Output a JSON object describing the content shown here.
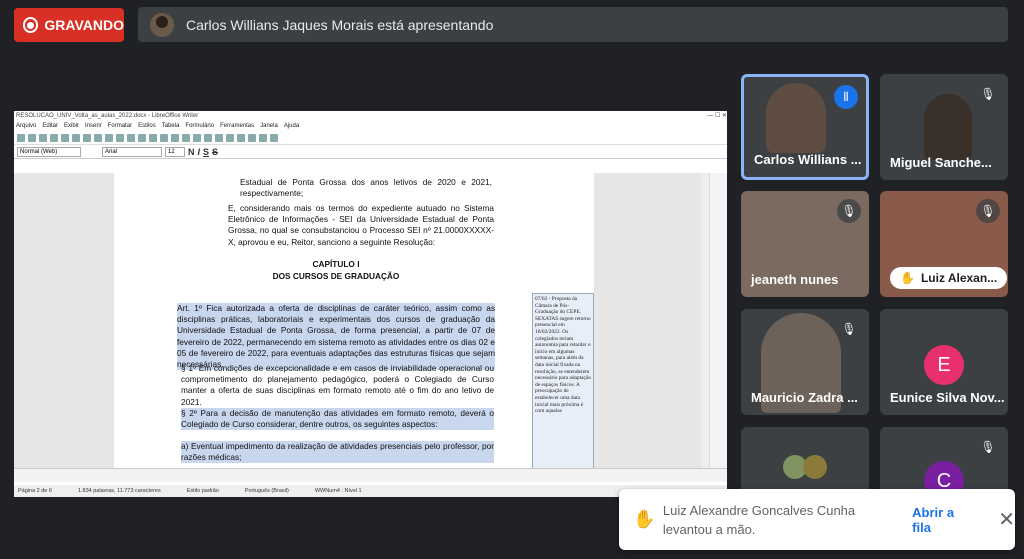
{
  "recording": {
    "label": "GRAVANDO"
  },
  "presenter": {
    "text": "Carlos Willians Jaques Morais está apresentando"
  },
  "shared_window": {
    "title": "RESOLUCAO_UNIV_Volta_as_aulas_2022.docx - LibreOffice Writer",
    "menu": [
      "Arquivo",
      "Editar",
      "Exibir",
      "Inserir",
      "Formatar",
      "Estilos",
      "Tabela",
      "Formulário",
      "Ferramentas",
      "Janela",
      "Ajuda"
    ],
    "paragraph_style": "Normal (Web)",
    "font_name": "Arial",
    "font_size": "12",
    "doc": {
      "p1": "Estadual de Ponta Grossa dos anos letivos de 2020 e 2021, respectivamente;",
      "p2": "E, considerando mais os termos do expediente autuado no Sistema Eletrônico de Informações - SEI da Universidade Estadual de Ponta Grossa, no qual se consubstanciou o Processo SEI nº 21.0000XXXXX-X, aprovou e eu, Reitor, sanciono a seguinte Resolução:",
      "chapter": "CAPÍTULO I",
      "chapter_sub": "DOS CURSOS DE GRADUAÇÃO",
      "art1": "Art. 1º Fica autorizada a oferta de disciplinas de caráter teórico, assim como as disciplinas práticas, laboratoriais e experimentais dos cursos de graduação da Universidade Estadual de Ponta Grossa, de forma presencial, a partir de 07 de fevereiro de 2022, permanecendo em sistema remoto as atividades entre os dias 02 e 05 de fevereiro de 2022, para eventuais adaptações das estruturas físicas que sejam necessárias.",
      "par1": "§ 1º Em condições de excepcionalidade e em casos de inviabilidade operacional ou comprometimento do planejamento pedagógico, poderá o Colegiado de Curso manter a oferta de suas disciplinas em formato remoto até o fim do ano letivo de 2021.",
      "par2": "§ 2º Para a decisão de manutenção das atividades em formato remoto, deverá o Colegiado de Curso considerar, dentre outros, os seguintes aspectos:",
      "item_a": "a) Eventual impedimento da realização de atividades presenciais pelo professor, por razões médicas;"
    },
    "comment": "07/02 - Proposta da Câmara de Pós-Graduação do CEPE. SEXATAS sugere retorno presencial em 16/02/2022. Os colegiados teriam autonomia para retardar o início em algumas semanas, para além da data inicial fixada na resolução, se entenderem necessário para adaptação de espaços físicos. A preocupação de estabelecer uma data inicial mais próxima é com aquelas",
    "status": [
      "Página 2 de 6",
      "1.834 palavras, 11.773 caracteres",
      "Estilo padrão",
      "Português (Brasil)",
      "WWNum4 : Nível 1"
    ]
  },
  "participants": [
    {
      "name": "Carlos Willians ...",
      "active": true
    },
    {
      "name": "Miguel Sanche...",
      "muted": true
    },
    {
      "name": "jeaneth nunes",
      "muted": true
    },
    {
      "name": "Luiz Alexan...",
      "hand_raised": true,
      "muted": true
    },
    {
      "name": "Mauricio Zadra ...",
      "muted": true
    },
    {
      "name": "Eunice Silva Nov...",
      "initial": "E",
      "color": "#e8306e"
    },
    {
      "name": "",
      "muted": false
    },
    {
      "name": "",
      "initial": "C",
      "color": "#7b1fa2",
      "muted": true
    }
  ],
  "notification": {
    "text": "Luiz Alexandre Goncalves Cunha levantou a mão.",
    "action": "Abrir a fila"
  }
}
